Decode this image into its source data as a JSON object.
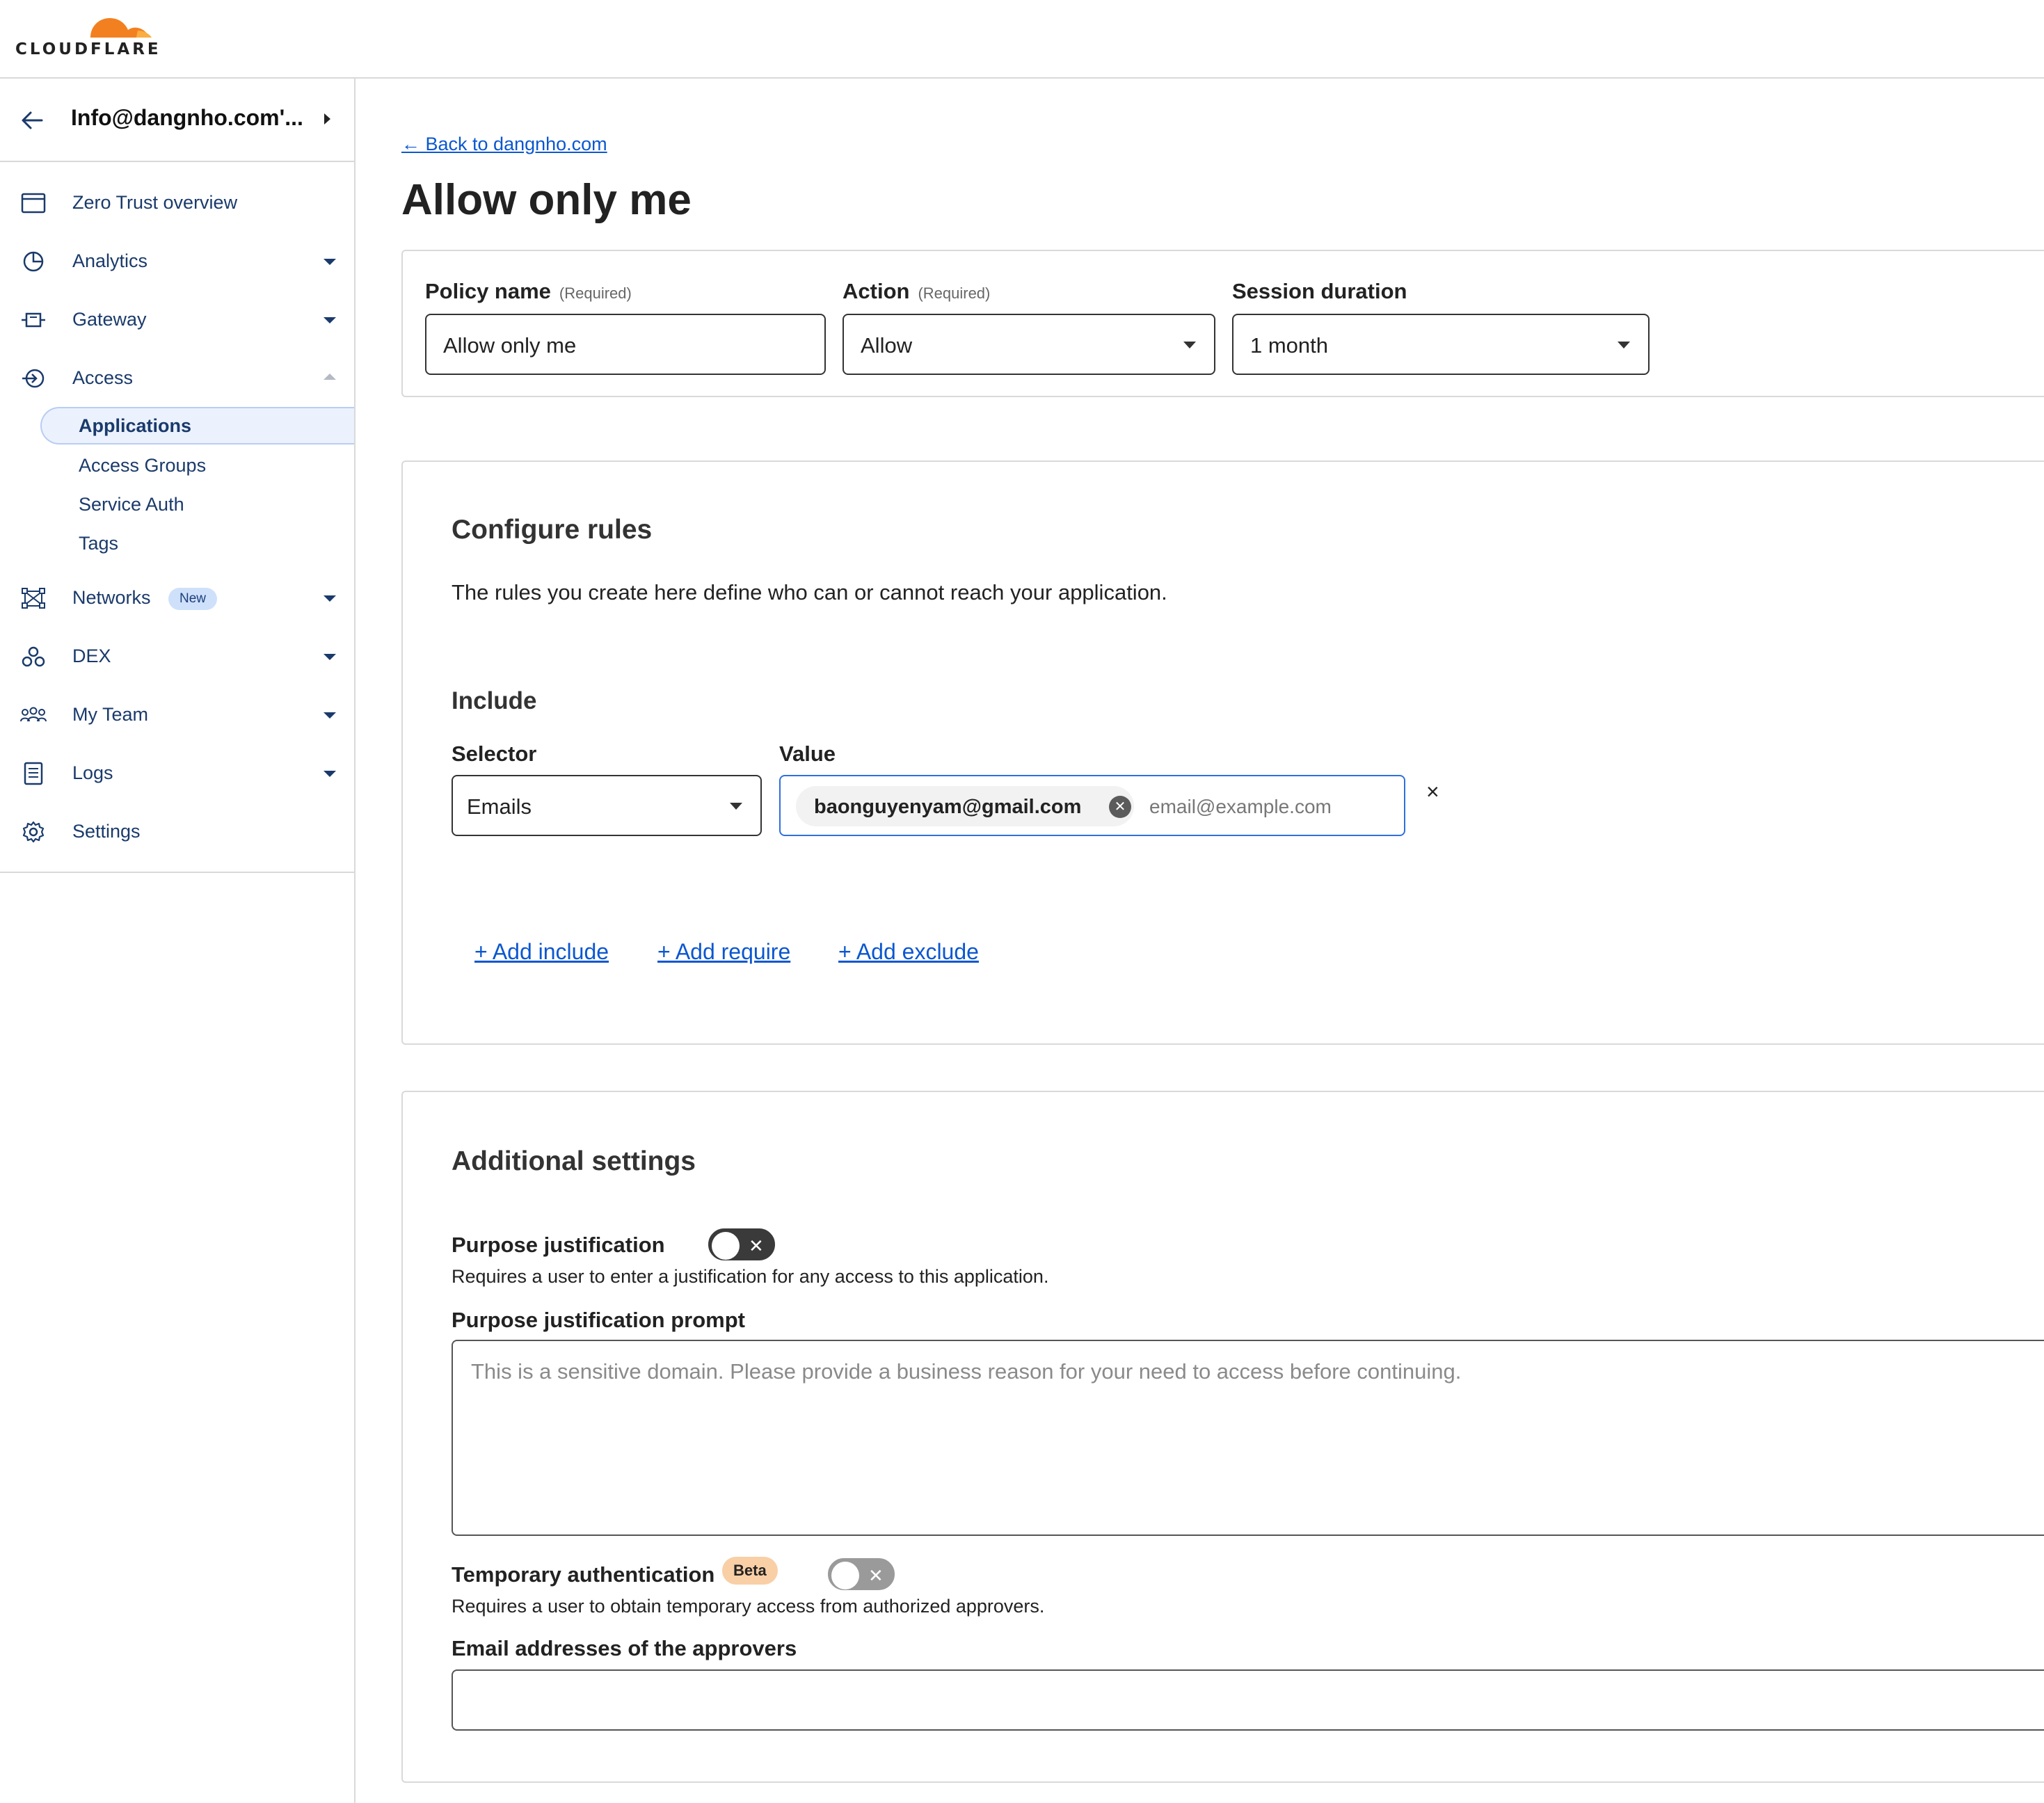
{
  "brand": {
    "name": "CLOUDFLARE",
    "orange": "#f38020",
    "light_orange": "#fbad41"
  },
  "sidebar": {
    "account": "Info@dangnho.com'...",
    "items": [
      {
        "label": "Zero Trust overview",
        "icon": "window-icon"
      },
      {
        "label": "Analytics",
        "icon": "pie-chart-icon"
      },
      {
        "label": "Gateway",
        "icon": "gateway-icon"
      },
      {
        "label": "Access",
        "icon": "access-icon"
      },
      {
        "label": "Networks",
        "icon": "network-icon",
        "badge": "New"
      },
      {
        "label": "DEX",
        "icon": "dex-icon"
      },
      {
        "label": "My Team",
        "icon": "team-icon"
      },
      {
        "label": "Logs",
        "icon": "logs-icon"
      },
      {
        "label": "Settings",
        "icon": "gear-icon"
      }
    ],
    "access_sub": [
      "Applications",
      "Access Groups",
      "Service Auth",
      "Tags"
    ]
  },
  "main": {
    "back_link": "← Back to dangnho.com",
    "title": "Allow only me",
    "policy": {
      "name_label": "Policy name",
      "required": "(Required)",
      "name_value": "Allow only me",
      "action_label": "Action",
      "action_value": "Allow",
      "session_label": "Session duration",
      "session_value": "1 month"
    },
    "rules": {
      "title": "Configure rules",
      "description": "The rules you create here define who can or cannot reach your application.",
      "include_title": "Include",
      "selector_label": "Selector",
      "value_label": "Value",
      "selector_value": "Emails",
      "chip_email": "baonguyenyam@gmail.com",
      "value_placeholder": "email@example.com",
      "add_include": "+ Add include",
      "add_require": "+ Add require",
      "add_exclude": "+ Add exclude"
    },
    "additional": {
      "title": "Additional settings",
      "purpose_label": "Purpose justification",
      "purpose_desc": "Requires a user to enter a justification for any access to this application.",
      "purpose_enabled": false,
      "prompt_label": "Purpose justification prompt",
      "prompt_placeholder": "This is a sensitive domain. Please provide a business reason for your need to access before continuing.",
      "temp_label": "Temporary authentication",
      "temp_badge": "Beta",
      "temp_desc": "Requires a user to obtain temporary access from authorized approvers.",
      "temp_enabled": false,
      "approvers_label": "Email addresses of the approvers"
    }
  }
}
